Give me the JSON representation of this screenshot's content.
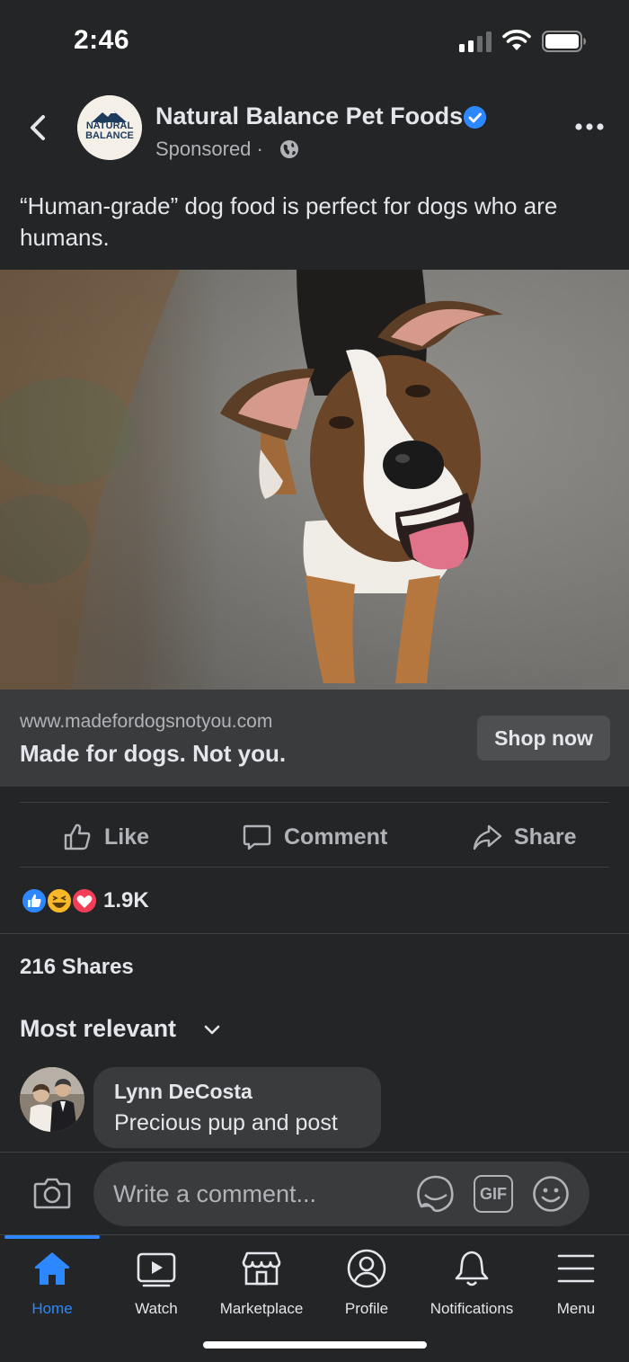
{
  "status_bar": {
    "time": "2:46"
  },
  "header": {
    "page_name": "Natural Balance Pet Foods",
    "sponsored": "Sponsored ·",
    "logo_text_1": "NATURAL",
    "logo_text_2": "BALANCE"
  },
  "post": {
    "text": "“Human-grade” dog food is perfect for dogs who are humans."
  },
  "link": {
    "url": "www.madefordogsnotyou.com",
    "title": "Made for dogs. Not you.",
    "cta": "Shop now"
  },
  "actions": {
    "like": "Like",
    "comment": "Comment",
    "share": "Share"
  },
  "reactions": {
    "count": "1.9K",
    "types": [
      "like-icon",
      "haha-icon",
      "love-icon"
    ]
  },
  "shares": "216 Shares",
  "sort": {
    "label": "Most relevant"
  },
  "comments": [
    {
      "name": "Lynn DeCosta",
      "text": "Precious pup and post"
    }
  ],
  "composer": {
    "placeholder": "Write a comment...",
    "gif": "GIF"
  },
  "tabs": [
    {
      "label": "Home",
      "icon": "home-icon",
      "active": true
    },
    {
      "label": "Watch",
      "icon": "watch-icon"
    },
    {
      "label": "Marketplace",
      "icon": "marketplace-icon"
    },
    {
      "label": "Profile",
      "icon": "profile-icon"
    },
    {
      "label": "Notifications",
      "icon": "bell-icon"
    },
    {
      "label": "Menu",
      "icon": "menu-icon"
    }
  ],
  "colors": {
    "accent": "#2d88ff",
    "background": "#242526",
    "card": "#3a3b3c",
    "text_secondary": "#b0b3b8"
  }
}
